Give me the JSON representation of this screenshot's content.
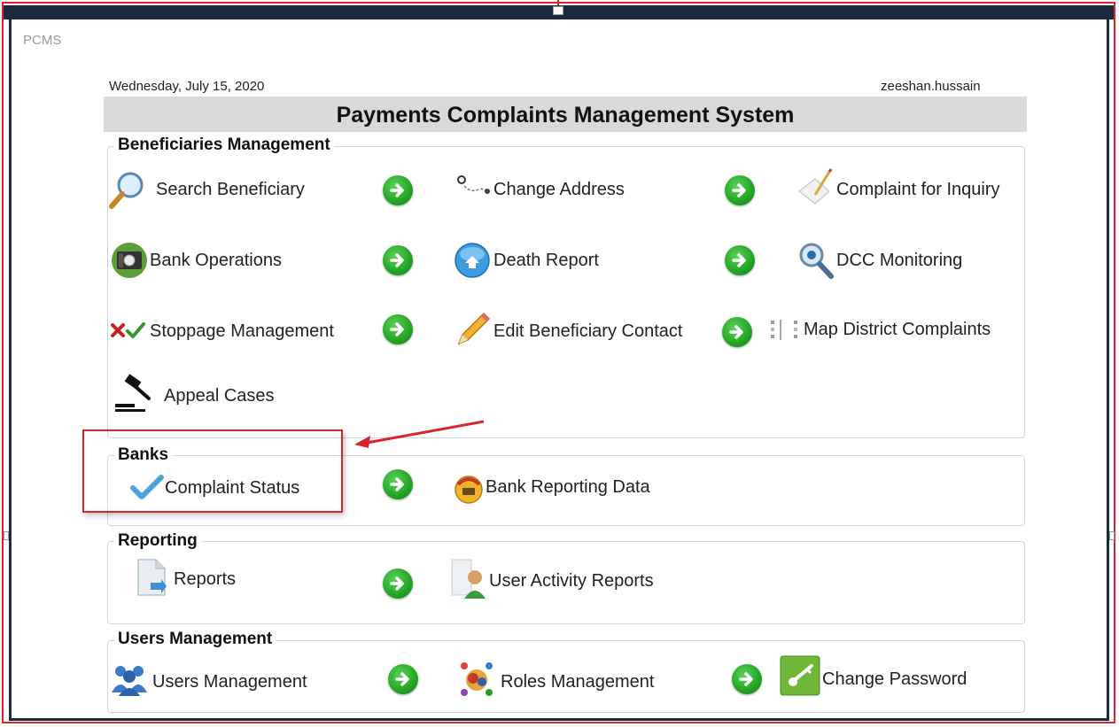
{
  "window": {
    "app_title": "PCMS",
    "date": "Wednesday, July 15, 2020",
    "user": "zeeshan.hussain",
    "title": "Payments Complaints Management System"
  },
  "groups": {
    "beneficiaries": {
      "label": "Beneficiaries Management",
      "items": {
        "search": "Search Beneficiary",
        "change_address": "Change Address",
        "complaint_inquiry": "Complaint for Inquiry",
        "bank_operations": "Bank Operations",
        "death_report": "Death Report",
        "dcc_monitoring": "DCC Monitoring",
        "stoppage": "Stoppage Management",
        "edit_contact": "Edit Beneficiary Contact",
        "map_district": "Map District Complaints",
        "appeal_cases": "Appeal Cases"
      }
    },
    "banks": {
      "label": "Banks",
      "items": {
        "complaint_status": "Complaint Status",
        "bank_reporting": "Bank Reporting Data"
      }
    },
    "reporting": {
      "label": "Reporting",
      "items": {
        "reports": "Reports",
        "user_activity": "User Activity Reports"
      }
    },
    "users": {
      "label": "Users Management",
      "items": {
        "users_management": "Users Management",
        "roles_management": "Roles Management",
        "change_password": "Change Password"
      }
    }
  },
  "colors": {
    "highlight": "#d6262b",
    "arrow_green": "#26a826",
    "banner_bg": "#d9d9d9",
    "frame": "#1b2a3e"
  },
  "icons": [
    "search-icon",
    "map-pin-icon",
    "pencil-note-icon",
    "bank-icon",
    "death-report-icon",
    "dcc-magnifier-icon",
    "stop-check-icon",
    "pencil-icon",
    "map-district-icon",
    "gavel-icon",
    "checkmark-icon",
    "bank-reporting-icon",
    "reports-icon",
    "user-activity-icon",
    "users-icon",
    "roles-icon",
    "key-icon",
    "arrow-right-icon"
  ]
}
